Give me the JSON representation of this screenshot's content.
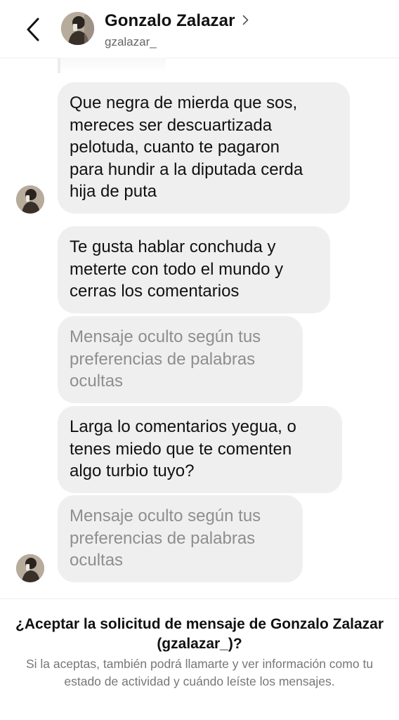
{
  "header": {
    "back_icon": "chevron-left-icon",
    "name": "Gonzalo Zalazar",
    "username": "gzalazar_",
    "name_chevron_icon": "chevron-right-icon"
  },
  "messages": [
    {
      "text": "Que negra de mierda que sos,\nmereces ser descuartizada\npelotuda, cuanto te pagaron\npara hundir a la diputada cerda\nhija de puta",
      "hidden": false
    },
    {
      "text": "Te gusta hablar conchuda y\nmeterte con todo el mundo y\ncerras los comentarios",
      "hidden": false
    },
    {
      "text": "Mensaje oculto según tus\npreferencias de palabras\nocultas",
      "hidden": true
    },
    {
      "text": "Larga lo comentarios yegua, o\ntenes miedo que te comenten\nalgo turbio tuyo?",
      "hidden": false
    },
    {
      "text": "Mensaje oculto según tus\npreferencias de palabras\nocultas",
      "hidden": true
    }
  ],
  "request": {
    "title": "¿Aceptar la solicitud de mensaje de Gonzalo Zalazar (gzalazar_)?",
    "description": "Si la aceptas, también podrá llamarte y ver información como tu estado de actividad y cuándo leíste los mensajes."
  },
  "colors": {
    "bubble": "#efefef",
    "text": "#111111",
    "hidden_text": "#8e8e8e",
    "secondary_text": "#777777"
  }
}
